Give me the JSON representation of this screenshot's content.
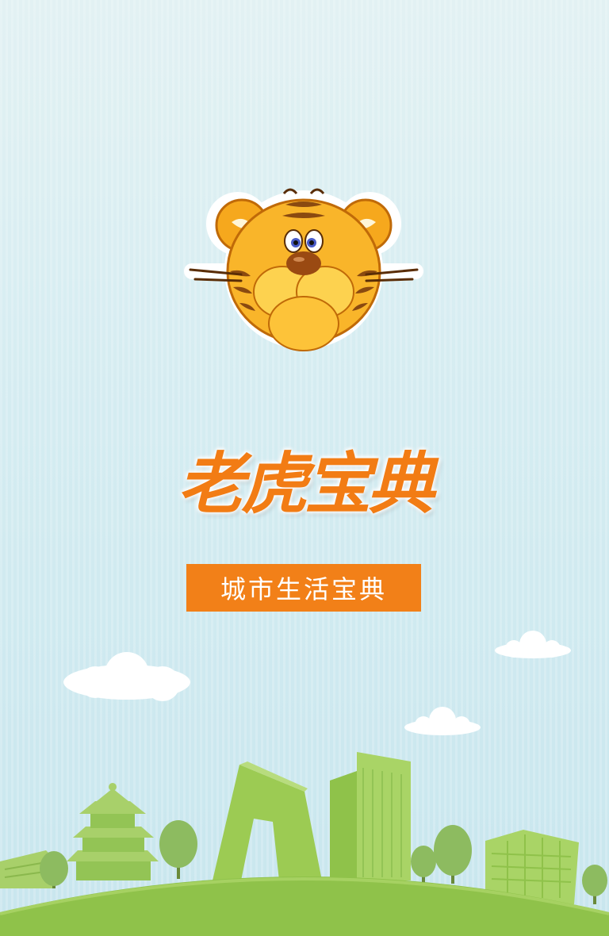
{
  "app": {
    "logo_name": "tiger-logo",
    "wordmark": "老虎宝典",
    "tagline": "城市生活宝典"
  },
  "colors": {
    "accent": "#f28018",
    "sky_top": "#e2f1f3",
    "sky_bottom": "#c8e6ee",
    "grass": "#8fc24a",
    "buildings": "#9ccb53"
  }
}
